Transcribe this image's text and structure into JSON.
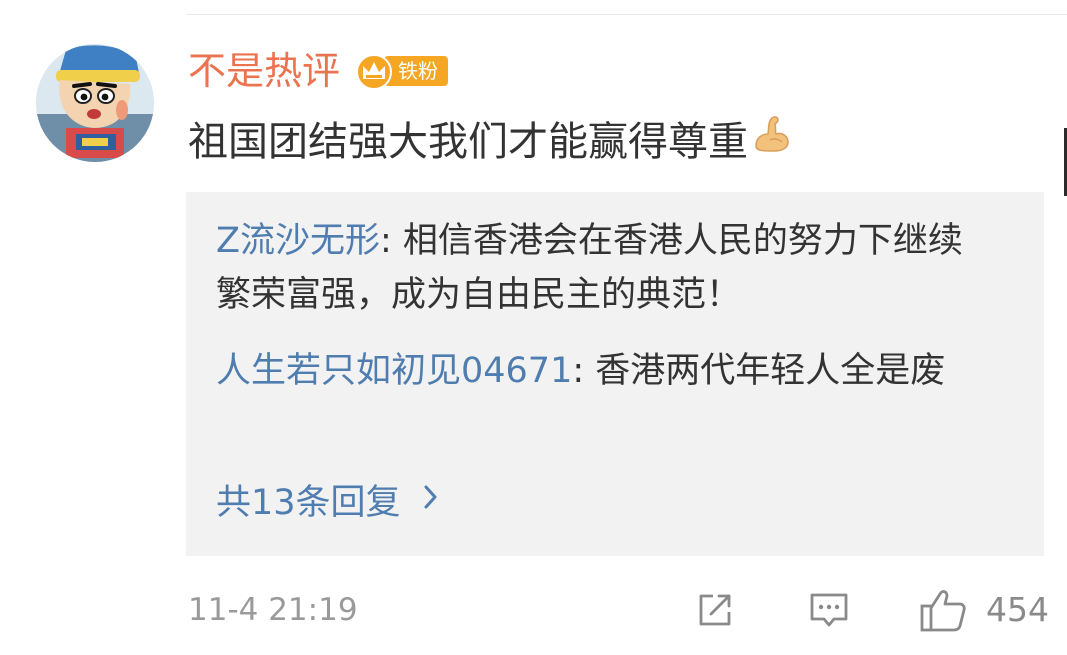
{
  "comment": {
    "username": "不是热评",
    "fan_badge": "铁粉",
    "text": "祖国团结强大我们才能赢得尊重",
    "emoji": "💪"
  },
  "replies": [
    {
      "author": "Z流沙无形",
      "separator": ": ",
      "text": "相信香港会在香港人民的努力下继续繁荣富强，成为自由民主的典范！"
    },
    {
      "author": "人生若只如初见04671",
      "separator": ": ",
      "text": "香港两代年轻人全是废"
    }
  ],
  "more_replies_label": "共13条回复",
  "more_replies_chevron": "›",
  "footer": {
    "timestamp": "11-4 21:19",
    "like_count": "454"
  },
  "icons": {
    "share": "share-icon",
    "comment": "comment-icon",
    "like": "thumbs-up-icon"
  },
  "colors": {
    "username": "#eb7350",
    "reply_author": "#507daf",
    "badge": "#f5a623",
    "reply_background": "#f2f2f2",
    "meta_gray": "#9a9a9a"
  }
}
